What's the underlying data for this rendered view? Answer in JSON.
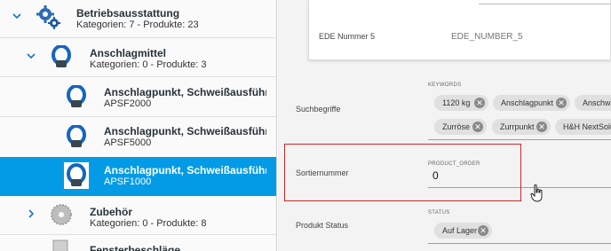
{
  "tree": {
    "items": [
      {
        "title": "Betriebsausstattung",
        "meta": "Kategorien: 7 - Produkte: 23",
        "icon": "gears-icon"
      },
      {
        "title": "Anschlagmittel",
        "meta": "Kategorien: 0 - Produkte: 3",
        "icon": "lifting-ring-icon"
      },
      {
        "title": "Anschlagpunkt, Schweißausführung, mit Feder",
        "sku": "APSF2000",
        "icon": "lifting-ring-icon"
      },
      {
        "title": "Anschlagpunkt, Schweißausführung, mit Feder",
        "sku": "APSF5000",
        "icon": "lifting-ring-icon"
      },
      {
        "title": "Anschlagpunkt, Schweißausführung, mit Feder",
        "sku": "APSF1000",
        "icon": "lifting-ring-icon",
        "selected": true
      },
      {
        "title": "Zubehör",
        "meta": "Kategorien: 0 - Produkte: 8",
        "icon": "saw-blade-icon"
      },
      {
        "title": "Fensterbeschläge",
        "meta": "",
        "icon": "window-fitting-icon"
      }
    ]
  },
  "main": {
    "ede_nummer_5": {
      "label": "EDE Nummer 5",
      "placeholder": "EDE_NUMBER_5"
    },
    "suchbegriffe": {
      "label": "Suchbegriffe",
      "caption": "KEYWORDS",
      "chips": [
        "1120 kg",
        "Anschlagpunkt",
        "Anschw",
        "Zurröse",
        "Zurrpunkt",
        "H&H NextSolu"
      ]
    },
    "sortiernummer": {
      "label": "Sortiernummer",
      "caption": "PRODUCT_ORDER",
      "value": "0"
    },
    "produkt_status": {
      "label": "Produkt Status",
      "caption": "STATUS",
      "chips": [
        "Auf Lager"
      ]
    }
  },
  "colors": {
    "accent": "#039be5",
    "highlight": "#c62828",
    "chevron": "#1a73c8"
  }
}
